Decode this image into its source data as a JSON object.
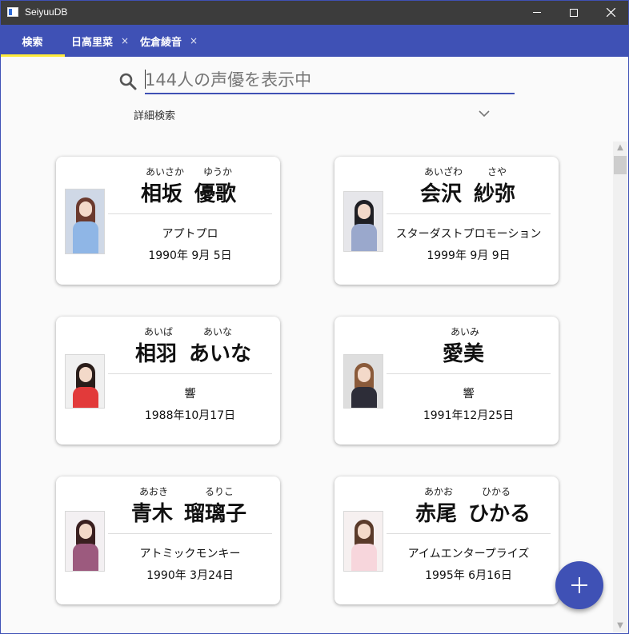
{
  "window": {
    "title": "SeiyuuDB",
    "controls": [
      "minimize-icon",
      "maximize-icon",
      "close-icon"
    ]
  },
  "tabs": [
    {
      "label": "検索",
      "active": true,
      "closable": false
    },
    {
      "label": "日高里菜",
      "active": false,
      "closable": true,
      "close_glyph": "×"
    },
    {
      "label": "佐倉綾音",
      "active": false,
      "closable": true,
      "close_glyph": "×"
    }
  ],
  "search": {
    "placeholder": "144人の声優を表示中",
    "value": "",
    "icon": "search-icon"
  },
  "advanced": {
    "label": "詳細検索",
    "icon": "chevron-down-icon",
    "expanded": false
  },
  "cards": [
    {
      "family_ruby": "あいさか",
      "given_ruby": "ゆうか",
      "family": "相坂",
      "given": "優歌",
      "agency": "アプトプロ",
      "birthday": "1990年 9月 5日"
    },
    {
      "family_ruby": "あいざわ",
      "given_ruby": "さや",
      "family": "会沢",
      "given": "紗弥",
      "agency": "スターダストプロモーション",
      "birthday": "1999年 9月 9日"
    },
    {
      "family_ruby": "あいば",
      "given_ruby": "あいな",
      "family": "相羽",
      "given": "あいな",
      "agency": "響",
      "birthday": "1988年10月17日"
    },
    {
      "family_ruby": "あいみ",
      "given_ruby": "",
      "family": "愛美",
      "given": "",
      "agency": "響",
      "birthday": "1991年12月25日"
    },
    {
      "family_ruby": "あおき",
      "given_ruby": "るりこ",
      "family": "青木",
      "given": "瑠璃子",
      "agency": "アトミックモンキー",
      "birthday": "1990年 3月24日"
    },
    {
      "family_ruby": "あかお",
      "given_ruby": "ひかる",
      "family": "赤尾",
      "given": "ひかる",
      "agency": "アイムエンタープライズ",
      "birthday": "1995年 6月16日"
    }
  ],
  "fab": {
    "icon": "plus-icon"
  },
  "colors": {
    "primary": "#3f51b5",
    "tab_indicator": "#ffeb3b",
    "titlebar": "#3c3c3c",
    "background": "#fafafa"
  }
}
